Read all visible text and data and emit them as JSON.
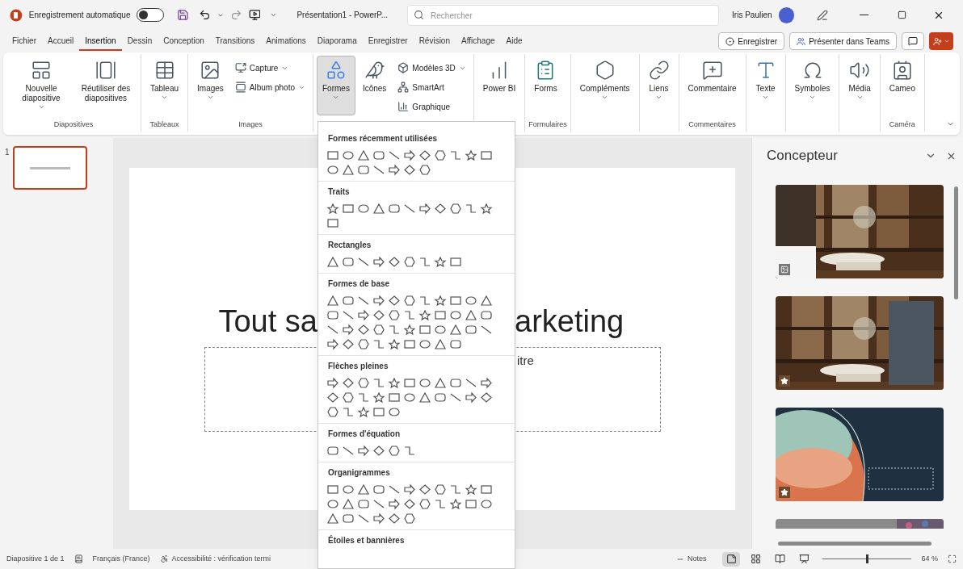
{
  "title_bar": {
    "autosave_label": "Enregistrement automatique",
    "autosave_on": false,
    "document_title": "Présentation1 - PowerP...",
    "search": {
      "placeholder": "Rechercher"
    },
    "user_name": "Iris Paulien"
  },
  "tabs": [
    {
      "label": "Fichier",
      "selected": false
    },
    {
      "label": "Accueil",
      "selected": false
    },
    {
      "label": "Insertion",
      "selected": true
    },
    {
      "label": "Dessin",
      "selected": false
    },
    {
      "label": "Conception",
      "selected": false
    },
    {
      "label": "Transitions",
      "selected": false
    },
    {
      "label": "Animations",
      "selected": false
    },
    {
      "label": "Diaporama",
      "selected": false
    },
    {
      "label": "Enregistrer",
      "selected": false
    },
    {
      "label": "Révision",
      "selected": false
    },
    {
      "label": "Affichage",
      "selected": false
    },
    {
      "label": "Aide",
      "selected": false
    }
  ],
  "tab_actions": [
    {
      "kind": "record",
      "label": "Enregistrer"
    },
    {
      "kind": "teams",
      "label": "Présenter dans Teams"
    },
    {
      "kind": "comments"
    },
    {
      "kind": "share"
    }
  ],
  "ribbon": {
    "groups": [
      {
        "label": "Diapositives",
        "items": [
          {
            "kind": "large",
            "label": "Nouvelle diapositive",
            "dropdown": true,
            "pressed": false
          },
          {
            "kind": "large",
            "label": "Réutiliser des diapositives",
            "dropdown": false,
            "pressed": false
          }
        ]
      },
      {
        "label": "Tableaux",
        "items": [
          {
            "kind": "large",
            "label": "Tableau",
            "dropdown": true,
            "pressed": false
          }
        ]
      },
      {
        "label": "Images",
        "items": [
          {
            "kind": "large",
            "label": "Images",
            "dropdown": true,
            "pressed": false
          },
          {
            "kind": "small",
            "label": "Capture",
            "dropdown": true,
            "pressed": false
          },
          {
            "kind": "small",
            "label": "Album photo",
            "dropdown": true,
            "pressed": false
          }
        ]
      },
      {
        "items": [
          {
            "kind": "large",
            "label": "Formes",
            "dropdown": true,
            "pressed": true
          },
          {
            "kind": "large",
            "label": "Icônes",
            "dropdown": false,
            "pressed": false
          },
          {
            "kind": "small",
            "label": "Modèles 3D",
            "dropdown": true,
            "pressed": false
          },
          {
            "kind": "small",
            "label": "SmartArt",
            "dropdown": false,
            "pressed": false
          },
          {
            "kind": "small",
            "label": "Graphique",
            "dropdown": false,
            "pressed": false
          }
        ]
      },
      {
        "items": [
          {
            "kind": "large",
            "label": "Power BI",
            "dropdown": false,
            "pressed": false
          }
        ]
      },
      {
        "label": "Formulaires",
        "items": [
          {
            "kind": "large",
            "label": "Forms",
            "dropdown": false,
            "pressed": false
          }
        ]
      },
      {
        "items": [
          {
            "kind": "large",
            "label": "Compléments",
            "dropdown": true,
            "pressed": false
          }
        ]
      },
      {
        "items": [
          {
            "kind": "large",
            "label": "Liens",
            "dropdown": true,
            "pressed": false
          }
        ]
      },
      {
        "label": "Commentaires",
        "items": [
          {
            "kind": "large",
            "label": "Commentaire",
            "dropdown": false,
            "pressed": false
          }
        ]
      },
      {
        "items": [
          {
            "kind": "large",
            "label": "Texte",
            "dropdown": true,
            "pressed": false
          }
        ]
      },
      {
        "items": [
          {
            "kind": "large",
            "label": "Symboles",
            "dropdown": true,
            "pressed": false
          }
        ]
      },
      {
        "items": [
          {
            "kind": "large",
            "label": "Média",
            "dropdown": true,
            "pressed": false
          }
        ]
      },
      {
        "label": "Caméra",
        "items": [
          {
            "kind": "large",
            "label": "Cameo",
            "dropdown": false,
            "pressed": false
          }
        ]
      }
    ]
  },
  "thumbnails": [
    {
      "number": "1",
      "selected": true
    }
  ],
  "slide": {
    "title_left": "Tout sa",
    "title_right": "arketing",
    "subtitle": "itre"
  },
  "shapes_menu": {
    "sections": [
      {
        "title": "Formes récemment utilisées"
      },
      {
        "title": "Traits"
      },
      {
        "title": "Rectangles"
      },
      {
        "title": "Formes de base"
      },
      {
        "title": "Flèches pleines"
      },
      {
        "title": "Formes d'équation"
      },
      {
        "title": "Organigrammes"
      },
      {
        "title": "Étoiles et bannières"
      }
    ]
  },
  "designer": {
    "title": "Concepteur",
    "designs": [
      {
        "kind": "image-badge"
      },
      {
        "kind": "star-badge"
      },
      {
        "kind": "star-badge"
      },
      {
        "kind": "plain"
      }
    ]
  },
  "status_bar": {
    "slide_count": "Diapositive 1 de 1",
    "language": "Français (France)",
    "accessibility": "Accessibilité : vérification termi",
    "notes": "Notes",
    "views": [
      {
        "kind": "normal",
        "selected": true
      },
      {
        "kind": "sorter",
        "selected": false
      },
      {
        "kind": "reading",
        "selected": false
      },
      {
        "kind": "slideshow",
        "selected": false
      }
    ],
    "zoom": {
      "level": 0.5,
      "reading": "64 %"
    }
  }
}
